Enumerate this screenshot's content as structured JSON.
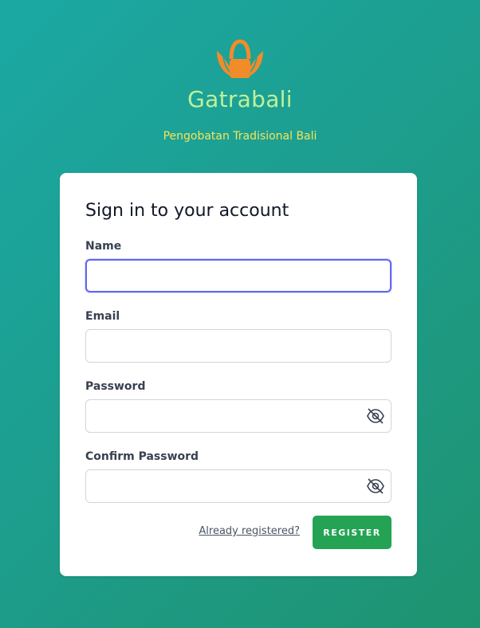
{
  "brand": {
    "logo_icon": "leaf-basket-icon",
    "name": "Gatrabali",
    "tagline": "Pengobatan Tradisional Bali",
    "colors": {
      "name": "#bff19a",
      "tagline": "#f6e45a",
      "logo": "#f28b2a"
    }
  },
  "form": {
    "title": "Sign in to your account",
    "fields": [
      {
        "label": "Name",
        "value": "",
        "focused": true
      },
      {
        "label": "Email",
        "value": ""
      },
      {
        "label": "Password",
        "value": "",
        "toggle_icon": "eye-slash-icon"
      },
      {
        "label": "Confirm Password",
        "value": "",
        "toggle_icon": "eye-slash-icon"
      }
    ],
    "login_link": "Already registered?",
    "submit_label": "REGISTER",
    "colors": {
      "submit": "#25a354",
      "focus_ring": "#6366f1"
    }
  }
}
